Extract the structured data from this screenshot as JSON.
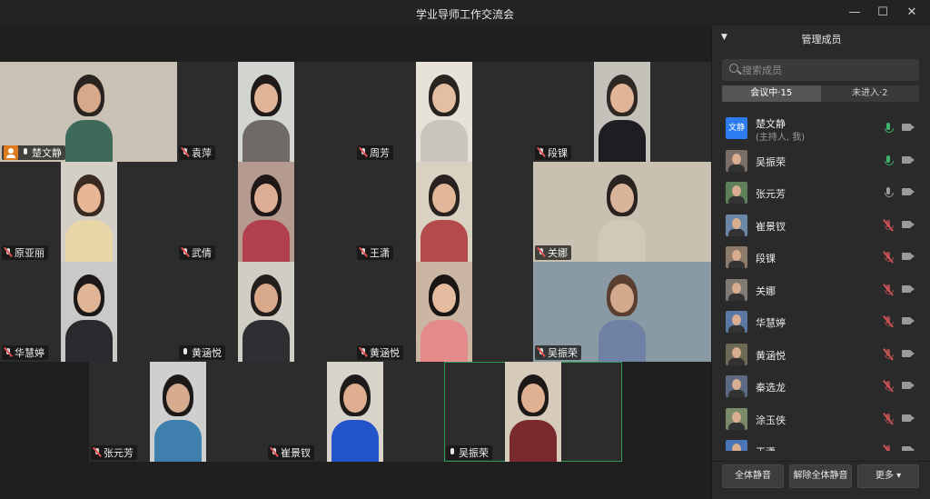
{
  "window": {
    "title": "学业导师工作交流会",
    "controls": [
      "minimize-icon",
      "maximize-icon",
      "close-icon"
    ]
  },
  "grid": {
    "tiles": [
      {
        "name": "楚文静",
        "mic": "on",
        "host": true
      },
      {
        "name": "袁萍",
        "mic": "off"
      },
      {
        "name": "周芳",
        "mic": "off"
      },
      {
        "name": "段锞",
        "mic": "off"
      },
      {
        "name": "原亚丽",
        "mic": "off"
      },
      {
        "name": "武倩",
        "mic": "off"
      },
      {
        "name": "王潇",
        "mic": "off"
      },
      {
        "name": "关娜",
        "mic": "off"
      },
      {
        "name": "华慧婷",
        "mic": "off"
      },
      {
        "name": "黄涵悦",
        "mic": "on"
      },
      {
        "name": "黄涵悦",
        "mic": "off"
      },
      {
        "name": "吴振荣",
        "mic": "off"
      },
      {
        "name": "张元芳",
        "mic": "off"
      },
      {
        "name": "崔景钗",
        "mic": "off"
      },
      {
        "name": "吴振荣",
        "mic": "on",
        "active": true
      }
    ]
  },
  "sidebar": {
    "title": "管理成员",
    "search_placeholder": "搜索成员",
    "tabs": [
      {
        "label": "会议中·15",
        "selected": true
      },
      {
        "label": "未进入·2",
        "selected": false
      }
    ],
    "members": [
      {
        "name": "楚文静",
        "sub": "(主持人, 我)",
        "avatar_text": "文静",
        "mic": "speaking"
      },
      {
        "name": "吴振荣",
        "mic": "speaking"
      },
      {
        "name": "张元芳",
        "mic": "on"
      },
      {
        "name": "崔景钗",
        "mic": "muted"
      },
      {
        "name": "段锞",
        "mic": "muted"
      },
      {
        "name": "关娜",
        "mic": "muted"
      },
      {
        "name": "华慧婷",
        "mic": "muted"
      },
      {
        "name": "黄涵悦",
        "mic": "muted"
      },
      {
        "name": "秦选龙",
        "mic": "muted"
      },
      {
        "name": "涂玉侠",
        "mic": "muted"
      },
      {
        "name": "王潇",
        "mic": "muted"
      }
    ],
    "footer": {
      "mute_all": "全体静音",
      "unmute_all": "解除全体静音",
      "more": "更多 ▾"
    }
  }
}
